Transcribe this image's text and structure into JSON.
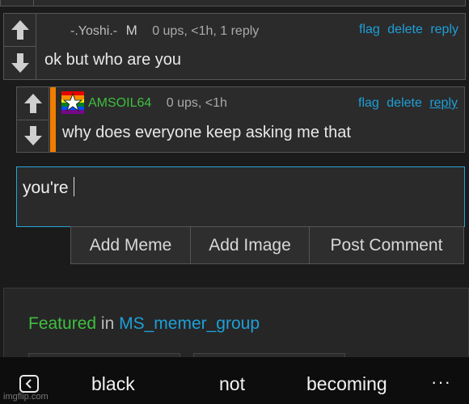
{
  "top_comment": {
    "username": "-.Yoshi.-",
    "badge": "M",
    "meta": "0 ups, <1h, 1 reply",
    "actions": [
      "flag",
      "delete",
      "reply"
    ],
    "text": "ok but who are you"
  },
  "reply_comment": {
    "username": "AMSOIL64",
    "meta": "0 ups, <1h",
    "actions": [
      "flag",
      "delete",
      "reply"
    ],
    "text": "why does everyone keep asking me that",
    "accent_color": "#f07d00"
  },
  "reply_input": {
    "value": "you're"
  },
  "buttons": {
    "add_meme": "Add Meme",
    "add_image": "Add Image",
    "post_comment": "Post Comment"
  },
  "featured": {
    "label": "Featured",
    "in": "in",
    "group": "MS_memer_group"
  },
  "keyboard_suggestions": [
    "black",
    "not",
    "becoming"
  ],
  "keyboard_more": "···",
  "watermark": "imgflip.com",
  "colors": {
    "link": "#1e9fd8",
    "green": "#3fbf3f",
    "focus_border": "#2aa3d6"
  }
}
